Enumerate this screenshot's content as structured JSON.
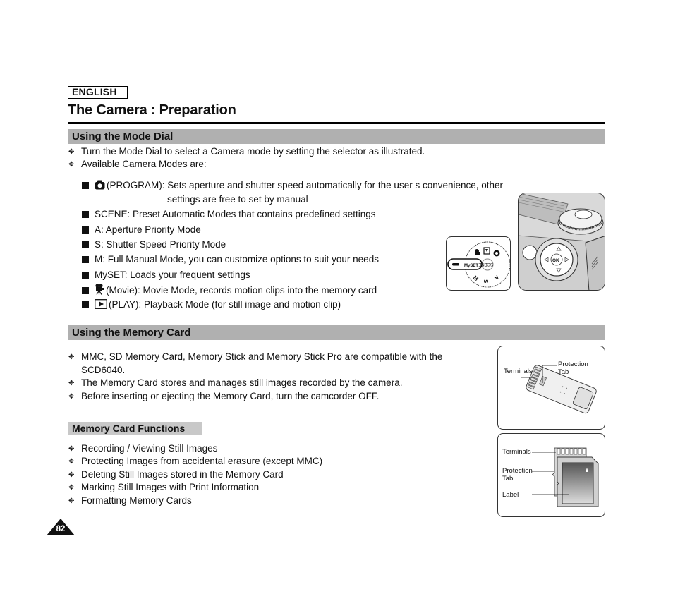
{
  "header": {
    "language_badge": "ENGLISH",
    "page_title": "The Camera : Preparation"
  },
  "mode_dial_section": {
    "heading": "Using the Mode Dial",
    "bullets": [
      "Turn the Mode Dial to select a Camera mode by setting the selector as illustrated.",
      "Available Camera Modes are:"
    ],
    "modes": [
      {
        "icon": "camera-icon",
        "text": "(PROGRAM): Sets aperture and shutter speed automatically for the user s convenience, other",
        "continuation": "settings are free to set by manual"
      },
      {
        "icon": "",
        "text": "SCENE: Preset Automatic Modes that contains predefined settings"
      },
      {
        "icon": "",
        "text": "A: Aperture Priority Mode"
      },
      {
        "icon": "",
        "text": "S: Shutter Speed Priority Mode"
      },
      {
        "icon": "",
        "text": "M: Full Manual Mode, you can customize options to suit your needs"
      },
      {
        "icon": "",
        "text": "MySET: Loads your frequent settings"
      },
      {
        "icon": "movie-camera-icon",
        "text": "(Movie): Movie Mode, records motion clips into the memory card"
      },
      {
        "icon": "play-icon",
        "text": "(PLAY): Playback Mode (for still image and motion clip)"
      }
    ],
    "dial_figure": {
      "labels": [
        "MySET",
        "SCENE",
        "A",
        "S",
        "M"
      ],
      "ok_label": "OK"
    }
  },
  "memory_card_section": {
    "heading": "Using the Memory Card",
    "bullets": [
      {
        "text": "MMC, SD Memory Card, Memory Stick and Memory Stick Pro are compatible with the",
        "continuation": "SCD6040."
      },
      {
        "text": "The Memory Card stores and manages still images recorded by the camera."
      },
      {
        "text": "Before inserting or ejecting the Memory Card, turn the camcorder OFF."
      }
    ],
    "functions": {
      "heading": "Memory Card Functions",
      "items": [
        "Recording / Viewing Still Images",
        "Protecting Images from accidental erasure (except MMC)",
        "Deleting Still Images stored in the Memory Card",
        "Marking Still Images with Print Information",
        "Formatting Memory Cards"
      ]
    },
    "memory_stick_figure": {
      "terminals_label": "Terminals",
      "protection_label_line1": "Protection",
      "protection_label_line2": "Tab"
    },
    "sd_card_figure": {
      "terminals_label": "Terminals",
      "protection_label_line1": "Protection",
      "protection_label_line2": "Tab",
      "label_label": "Label"
    }
  },
  "footer": {
    "page_number": "82"
  },
  "colors": {
    "section_bar": "#b0b0b0",
    "sub_bar": "#c8c8c8",
    "text": "#111111"
  }
}
